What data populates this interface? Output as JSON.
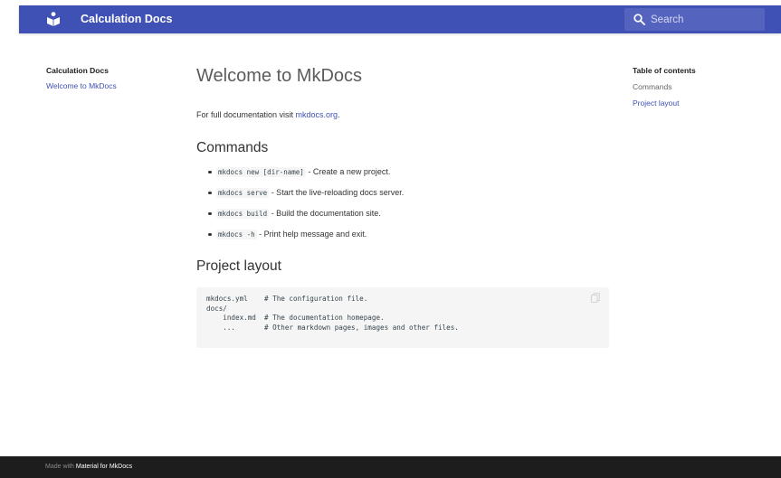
{
  "header": {
    "site_title": "Calculation Docs",
    "search": {
      "placeholder": "Search",
      "value": ""
    }
  },
  "nav": {
    "title": "Calculation Docs",
    "items": [
      {
        "label": "Welcome to MkDocs"
      }
    ]
  },
  "content": {
    "title": "Welcome to MkDocs",
    "intro_text": "For full documentation visit ",
    "intro_link": "mkdocs.org",
    "intro_end": ".",
    "commands_heading": "Commands",
    "commands": [
      {
        "code": "mkdocs new [dir-name]",
        "desc": " - Create a new project."
      },
      {
        "code": "mkdocs serve",
        "desc": " - Start the live-reloading docs server."
      },
      {
        "code": "mkdocs build",
        "desc": " - Build the documentation site."
      },
      {
        "code": "mkdocs -h",
        "desc": " - Print help message and exit."
      }
    ],
    "layout_heading": "Project layout",
    "layout_code": "mkdocs.yml    # The configuration file.\ndocs/\n    index.md  # The documentation homepage.\n    ...       # Other markdown pages, images and other files."
  },
  "toc": {
    "title": "Table of contents",
    "items": [
      {
        "label": "Commands"
      },
      {
        "label": "Project layout"
      }
    ]
  },
  "footer": {
    "prefix": "Made with ",
    "link": "Material for MkDocs"
  },
  "colors": {
    "primary": "#4051b5",
    "footer_bg": "#1d1d1d",
    "code_bg": "#f5f5f5"
  }
}
